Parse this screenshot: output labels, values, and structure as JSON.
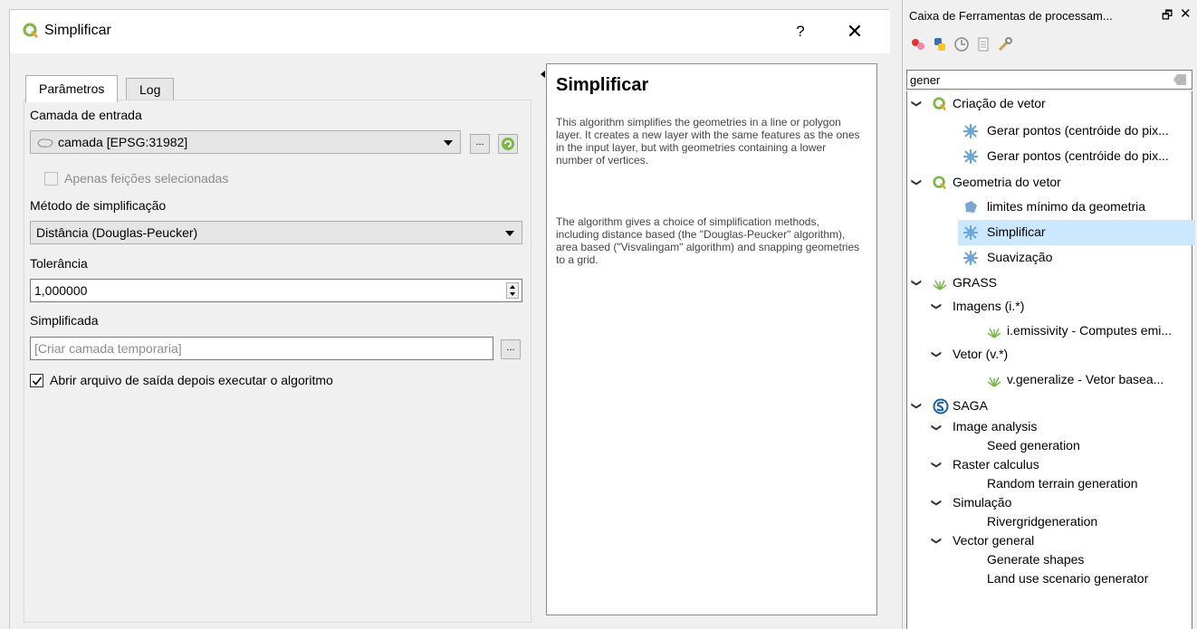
{
  "dialog": {
    "title": "Simplificar",
    "help_label": "?",
    "close_label": "✕",
    "tabs": [
      "Parâmetros",
      "Log"
    ],
    "input_layer": {
      "label": "Camada de entrada",
      "value": "camada [EPSG:31982]",
      "browse": "..."
    },
    "selected_only": "Apenas feições selecionadas",
    "method": {
      "label": "Método de simplificação",
      "value": "Distância (Douglas-Peucker)"
    },
    "tolerance": {
      "label": "Tolerância",
      "value": "1,000000"
    },
    "output": {
      "label": "Simplificada",
      "placeholder": "[Criar camada temporaria]",
      "browse": "..."
    },
    "open_output": "Abrir arquivo de saída depois executar o algoritmo",
    "help": {
      "title": "Simplificar",
      "p1": "This algorithm simplifies the geometries in a line or polygon layer. It creates a new layer with the same features as the ones in the input layer, but with geometries containing a lower number of vertices.",
      "p2": "The algorithm gives a choice of simplification methods, including distance based (the \"Douglas-Peucker\" algorithm), area based (\"Visvalingam\" algorithm) and snapping geometries to a grid."
    }
  },
  "toolbox": {
    "title": "Caixa de Ferramentas de processam...",
    "float_icon": "restore-icon",
    "close_label": "✕",
    "search": "gener",
    "tree": {
      "vector_creation": "Criação de vetor",
      "gen_points_1": "Gerar pontos (centróide do pix...",
      "gen_points_2": "Gerar pontos (centróide do pix...",
      "vector_geometry": "Geometria do vetor",
      "min_bounds": "limites mínimo da geometria",
      "simplify": "Simplificar",
      "smooth": "Suavização",
      "grass": "GRASS",
      "images": "Imagens (i.*)",
      "emissivity": "i.emissivity - Computes emi...",
      "vector": "Vetor (v.*)",
      "generalize": "v.generalize - Vetor basea...",
      "saga": "SAGA",
      "image_analysis": "Image analysis",
      "seed_generation": "Seed generation",
      "raster_calculus": "Raster calculus",
      "random_terrain": "Random terrain generation",
      "simulation": "Simulação",
      "rivergrid": "Rivergridgeneration",
      "vector_general": "Vector general",
      "generate_shapes": "Generate shapes",
      "land_use": "Land use scenario generator"
    }
  },
  "colors": {
    "qgis_green": "#7ab648",
    "selection": "#cce8ff",
    "gear_blue": "#6fa7d9"
  }
}
